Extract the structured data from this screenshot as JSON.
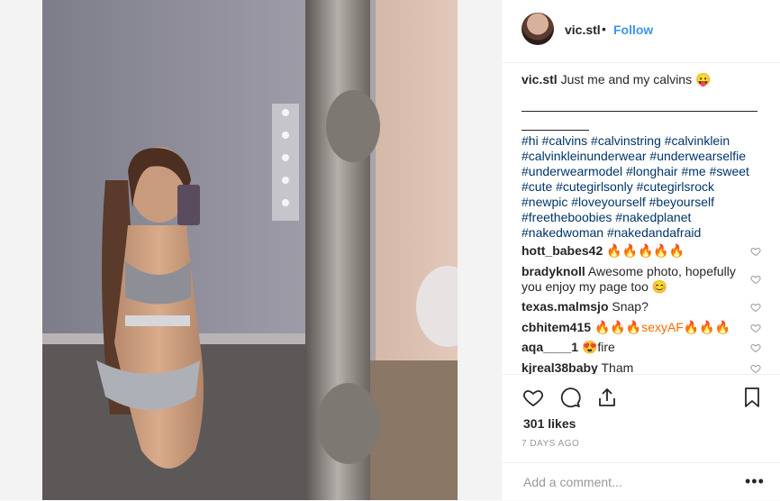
{
  "post": {
    "author": "vic.stl",
    "follow_label": "Follow",
    "dot": "•",
    "caption_text": "Just me and my calvins 😛",
    "divider_line": "",
    "hashtags": [
      "#hi #calvins #calvinstring #calvinklein",
      "#calvinkleinunderwear #underwearselfie",
      "#underwearmodel #longhair #me #sweet",
      "#cute #cutegirlsonly #cutegirlsrock",
      "#newpic #loveyourself #beyourself",
      "#freetheboobies #nakedplanet",
      "#nakedwoman #nakedandafraid"
    ],
    "likes": "301 likes",
    "date": "7 DAYS AGO",
    "add_comment_placeholder": "Add a comment...",
    "more_label": "•••"
  },
  "comments": [
    {
      "user": "hott_babes42",
      "text": "🔥🔥🔥🔥🔥"
    },
    {
      "user": "bradyknoll",
      "text": "Awesome photo, hopefully you enjoy my page too 😊"
    },
    {
      "user": "texas.malmsjo",
      "text": "Snap?"
    },
    {
      "user": "cbhitem415",
      "text": "🔥🔥🔥sexyAF🔥🔥🔥"
    },
    {
      "user": "aqa____1",
      "text": "😍fire"
    },
    {
      "user": "kjreal38baby",
      "text": "Tham"
    }
  ],
  "icons": {
    "like": "heart-icon",
    "comment": "comment-bubble-icon",
    "share": "share-icon",
    "save": "bookmark-icon",
    "comment_like": "heart-outline-icon"
  },
  "colors": {
    "follow": "#3897f0",
    "hashtag": "#003569",
    "muted": "#999999"
  }
}
